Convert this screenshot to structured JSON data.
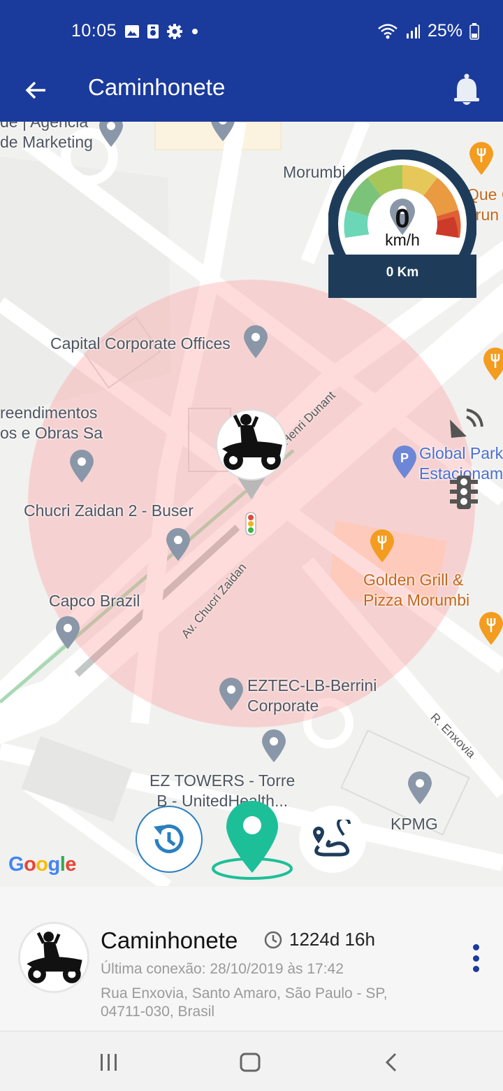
{
  "colors": {
    "primary": "#1a3a9c",
    "accent_green": "#1dbf98",
    "accent_blue": "#2a7fc0",
    "geofence": "#ffb0b0"
  },
  "status_bar": {
    "time": "10:05",
    "battery": "25%",
    "icons": [
      "image-icon",
      "storage-icon",
      "gear-icon",
      "dot-icon",
      "wifi-icon",
      "signal-icon",
      "battery-icon"
    ]
  },
  "app_bar": {
    "title": "Caminhonete",
    "back_icon": "arrow-left-icon",
    "notification_icon": "bell-icon"
  },
  "map": {
    "labels": {
      "agency": "de | Agência\nde Marketing",
      "morumbi": "Morumbi",
      "que": "Que C\norun",
      "capital": "Capital Corporate Offices",
      "empreendimentos": "reendimentos\nos e Obras Sa",
      "chucri": "Chucri Zaidan 2 - Buser",
      "capco": "Capco Brazil",
      "global_park": "Global Park\nEstacionam",
      "golden_grill": "Golden Grill &\nPizza Morumbi",
      "eztec": "EZTEC-LB-Berrini\nCorporate",
      "ez_towers": "EZ TOWERS - Torre\nB - UnitedHealth...",
      "kpmg": "KPMG",
      "henri_dunant": "R. Henri Dunant",
      "chucri_zaidan": "Av. Chucri Zaidan",
      "enxovia": "R. Enxovia"
    },
    "google": "Google",
    "speedometer": {
      "speed": "0",
      "unit": "km/h",
      "odometer": "0 Km"
    },
    "fabs": {
      "history": "history-icon",
      "location": "location-pin-icon",
      "route": "route-icon"
    }
  },
  "pager": {
    "count": 3,
    "active": 0
  },
  "vehicle_card": {
    "name": "Caminhonete",
    "duration": "1224d 16h",
    "last_connection": "Última conexão: 28/10/2019 às 17:42",
    "address": "Rua Enxovia, Santo Amaro, São Paulo - SP, 04711-030, Brasil"
  },
  "nav_bar": {
    "buttons": [
      "recent-apps-icon",
      "home-icon",
      "back-icon"
    ]
  }
}
